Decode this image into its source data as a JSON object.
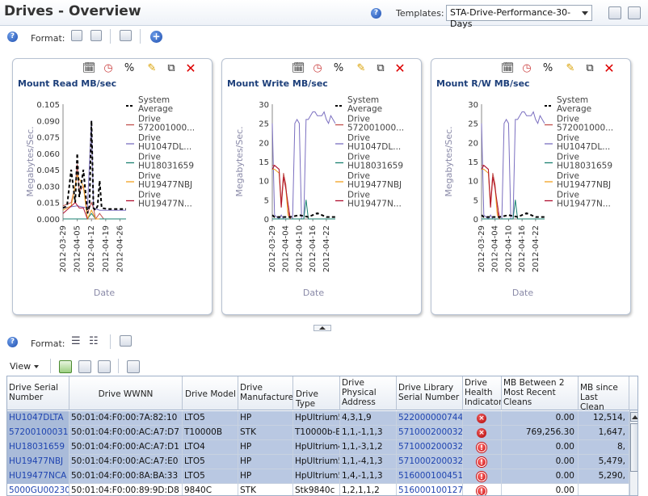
{
  "header": {
    "title": "Drives - Overview",
    "templates_label": "Templates:",
    "template_selected": "STA-Drive-Performance-30-Days"
  },
  "toolbar1": {
    "format_label": "Format:"
  },
  "toolbar2": {
    "format_label": "Format:",
    "view_label": "View"
  },
  "legend": [
    "System Average",
    "Drive 572001000...",
    "Drive HU1047DL...",
    "Drive HU18031659",
    "Drive HU19477NBJ",
    "Drive HU19477N..."
  ],
  "legend_lines": [
    [
      "System",
      "Average"
    ],
    [
      "Drive",
      "572001000..."
    ],
    [
      "Drive",
      "HU1047DL..."
    ],
    [
      "Drive",
      "HU18031659"
    ],
    [
      "Drive",
      "HU19477NBJ"
    ],
    [
      "Drive",
      "HU19477N..."
    ]
  ],
  "series_colors": [
    "#000000",
    "#c0504d",
    "#7b6fc0",
    "#1a8070",
    "#f0a020",
    "#b01030"
  ],
  "chart_data": [
    {
      "type": "line",
      "title": "Mount Read MB/sec",
      "xlabel": "Date",
      "ylabel": "Megabytes/Sec.",
      "ylim": [
        0,
        0.105
      ],
      "yticks": [
        "0.105",
        "0.090",
        "0.075",
        "0.060",
        "0.045",
        "0.030",
        "0.015",
        "0.000"
      ],
      "ytick_values": [
        0.105,
        0.09,
        0.075,
        0.06,
        0.045,
        0.03,
        0.015,
        0
      ],
      "xticks": [
        "2012-03-29",
        "2012-04-05",
        "2012-04-12",
        "2012-04-19",
        "2012-04-26"
      ],
      "xlim": [
        "2012-03-29",
        "2012-04-29"
      ],
      "series": [
        {
          "x": [
            "2012-03-29",
            "2012-03-31",
            "2012-04-02",
            "2012-04-04",
            "2012-04-05",
            "2012-04-06",
            "2012-04-08",
            "2012-04-10",
            "2012-04-11",
            "2012-04-12",
            "2012-04-13",
            "2012-04-14",
            "2012-04-15",
            "2012-04-16",
            "2012-04-17",
            "2012-04-20",
            "2012-04-24",
            "2012-04-29"
          ],
          "y": [
            0.01,
            0.012,
            0.045,
            0.015,
            0.06,
            0.02,
            0.045,
            0.005,
            0.012,
            0.09,
            0.01,
            0.008,
            0.012,
            0.035,
            0.01,
            0.009,
            0.009,
            0.009
          ]
        },
        {
          "x": [
            "2012-03-29",
            "2012-04-02",
            "2012-04-04",
            "2012-04-05",
            "2012-04-06",
            "2012-04-08",
            "2012-04-10",
            "2012-04-12",
            "2012-04-13",
            "2012-04-14",
            "2012-04-16",
            "2012-04-18"
          ],
          "y": [
            0.012,
            0.015,
            0.03,
            0.05,
            0.025,
            0.03,
            0.005,
            0.015,
            0.01,
            0.0,
            0.005,
            0.0
          ]
        },
        {
          "x": [
            "2012-03-29",
            "2012-04-05",
            "2012-04-10",
            "2012-04-12",
            "2012-04-13",
            "2012-04-16",
            "2012-04-20",
            "2012-04-29"
          ],
          "y": [
            0.01,
            0.012,
            0.01,
            0.09,
            0.01,
            0.008,
            0.008,
            0.008
          ]
        },
        {
          "x": [
            "2012-03-29",
            "2012-04-10",
            "2012-04-12",
            "2012-04-14",
            "2012-04-29"
          ],
          "y": [
            0.0,
            0.0,
            0.005,
            0.0,
            0.0
          ]
        },
        {
          "x": [
            "2012-03-29",
            "2012-04-02",
            "2012-04-05",
            "2012-04-08",
            "2012-04-10",
            "2012-04-12",
            "2012-04-14",
            "2012-04-16"
          ],
          "y": [
            0.008,
            0.012,
            0.04,
            0.03,
            0.0,
            0.008,
            0.0,
            0.0
          ]
        },
        {
          "x": [
            "2012-03-29",
            "2012-04-04",
            "2012-04-06",
            "2012-04-08",
            "2012-04-10"
          ],
          "y": [
            0.005,
            0.015,
            0.01,
            0.01,
            0.0
          ]
        }
      ]
    },
    {
      "type": "line",
      "title": "Mount Write MB/sec",
      "xlabel": "Date",
      "ylabel": "Megabytes/Sec.",
      "ylim": [
        0,
        30
      ],
      "yticks": [
        "30",
        "25",
        "20",
        "15",
        "10",
        "5",
        "0"
      ],
      "ytick_values": [
        30,
        25,
        20,
        15,
        10,
        5,
        0
      ],
      "xticks": [
        "2012-03-29",
        "2012-04-04",
        "2012-04-10",
        "2012-04-16",
        "2012-04-22"
      ],
      "xlim": [
        "2012-03-29",
        "2012-04-26"
      ],
      "series": [
        {
          "x": [
            "2012-03-29",
            "2012-03-30",
            "2012-04-01",
            "2012-04-06",
            "2012-04-10",
            "2012-04-14",
            "2012-04-18",
            "2012-04-22",
            "2012-04-26"
          ],
          "y": [
            1,
            0.5,
            0.5,
            0.5,
            1,
            0.5,
            1.5,
            0.5,
            0.5
          ]
        },
        {
          "x": [
            "2012-03-29",
            "2012-03-30",
            "2012-04-01",
            "2012-04-02",
            "2012-04-03",
            "2012-04-04",
            "2012-04-05",
            "2012-04-06"
          ],
          "y": [
            14,
            14,
            13,
            4,
            12,
            9,
            2,
            0
          ]
        },
        {
          "x": [
            "2012-03-29",
            "2012-03-30",
            "2012-04-01",
            "2012-04-02",
            "2012-04-03",
            "2012-04-06",
            "2012-04-07",
            "2012-04-08",
            "2012-04-09",
            "2012-04-10",
            "2012-04-11",
            "2012-04-12",
            "2012-04-13",
            "2012-04-14",
            "2012-04-16",
            "2012-04-17",
            "2012-04-18",
            "2012-04-19",
            "2012-04-20",
            "2012-04-21",
            "2012-04-22",
            "2012-04-23",
            "2012-04-24",
            "2012-04-26"
          ],
          "y": [
            25,
            1,
            0,
            1,
            0,
            0,
            0,
            25,
            26,
            25,
            0,
            0,
            26,
            26,
            28,
            28,
            27,
            27,
            27,
            28,
            26,
            25,
            27,
            25
          ]
        },
        {
          "x": [
            "2012-03-29",
            "2012-04-12",
            "2012-04-13",
            "2012-04-14",
            "2012-04-16",
            "2012-04-17",
            "2012-04-26"
          ],
          "y": [
            0,
            0,
            5,
            0,
            0,
            0,
            0
          ]
        },
        {
          "x": [
            "2012-03-29",
            "2012-03-30",
            "2012-04-01",
            "2012-04-02",
            "2012-04-03",
            "2012-04-04",
            "2012-04-05",
            "2012-04-06"
          ],
          "y": [
            13,
            13,
            12,
            3,
            11,
            8,
            1,
            0
          ]
        },
        {
          "x": [
            "2012-03-29",
            "2012-03-30",
            "2012-04-01",
            "2012-04-02",
            "2012-04-03",
            "2012-04-04",
            "2012-04-06"
          ],
          "y": [
            13,
            14,
            13,
            3,
            11,
            8,
            0
          ]
        }
      ]
    },
    {
      "type": "line",
      "title": "Mount R/W MB/sec",
      "xlabel": "Date",
      "ylabel": "Megabytes/Sec.",
      "ylim": [
        0,
        30
      ],
      "yticks": [
        "30",
        "25",
        "20",
        "15",
        "10",
        "5",
        "0"
      ],
      "ytick_values": [
        30,
        25,
        20,
        15,
        10,
        5,
        0
      ],
      "xticks": [
        "2012-03-29",
        "2012-04-04",
        "2012-04-10",
        "2012-04-16",
        "2012-04-22"
      ],
      "xlim": [
        "2012-03-29",
        "2012-04-26"
      ],
      "series": [
        {
          "x": [
            "2012-03-29",
            "2012-03-30",
            "2012-04-01",
            "2012-04-06",
            "2012-04-10",
            "2012-04-14",
            "2012-04-18",
            "2012-04-22",
            "2012-04-26"
          ],
          "y": [
            1,
            0.5,
            0.5,
            0.5,
            1,
            0.5,
            1.5,
            0.5,
            0.5
          ]
        },
        {
          "x": [
            "2012-03-29",
            "2012-03-30",
            "2012-04-01",
            "2012-04-02",
            "2012-04-03",
            "2012-04-04",
            "2012-04-05",
            "2012-04-06"
          ],
          "y": [
            14,
            14,
            13,
            4,
            12,
            9,
            2,
            0
          ]
        },
        {
          "x": [
            "2012-03-29",
            "2012-03-30",
            "2012-04-01",
            "2012-04-02",
            "2012-04-03",
            "2012-04-06",
            "2012-04-07",
            "2012-04-08",
            "2012-04-09",
            "2012-04-10",
            "2012-04-11",
            "2012-04-12",
            "2012-04-13",
            "2012-04-14",
            "2012-04-16",
            "2012-04-17",
            "2012-04-18",
            "2012-04-19",
            "2012-04-20",
            "2012-04-21",
            "2012-04-22",
            "2012-04-23",
            "2012-04-24",
            "2012-04-26"
          ],
          "y": [
            25,
            1,
            0,
            1,
            0,
            0,
            0,
            25,
            26,
            25,
            0,
            0,
            26,
            26,
            28,
            28,
            27,
            27,
            27,
            28,
            26,
            25,
            27,
            25
          ]
        },
        {
          "x": [
            "2012-03-29",
            "2012-04-12",
            "2012-04-13",
            "2012-04-14",
            "2012-04-16",
            "2012-04-17",
            "2012-04-26"
          ],
          "y": [
            0,
            0,
            5,
            0,
            0,
            0,
            0
          ]
        },
        {
          "x": [
            "2012-03-29",
            "2012-03-30",
            "2012-04-01",
            "2012-04-02",
            "2012-04-03",
            "2012-04-04",
            "2012-04-05",
            "2012-04-06"
          ],
          "y": [
            13,
            13,
            12,
            3,
            11,
            8,
            1,
            0
          ]
        },
        {
          "x": [
            "2012-03-29",
            "2012-03-30",
            "2012-04-01",
            "2012-04-02",
            "2012-04-03",
            "2012-04-04",
            "2012-04-06"
          ],
          "y": [
            13,
            14,
            13,
            3,
            11,
            8,
            0
          ]
        }
      ]
    }
  ],
  "table": {
    "columns": [
      [
        "Drive Serial",
        "Number"
      ],
      [
        "Drive WWNN"
      ],
      [
        "Drive Model"
      ],
      [
        "Drive",
        "Manufacturer"
      ],
      [
        "Drive Type"
      ],
      [
        "Drive",
        "Physical",
        "Address"
      ],
      [
        "Drive Library",
        "Serial Number"
      ],
      [
        "Drive",
        "Health",
        "Indicator"
      ],
      [
        "MB Between 2",
        "Most Recent",
        "Cleans"
      ],
      [
        "MB since Last",
        "Clean"
      ]
    ],
    "rows": [
      {
        "serial": "HU1047DLTA",
        "wwnn": "50:01:04:F0:00:7A:82:10",
        "model": "LTO5",
        "mfr": "HP",
        "type": "HpUltrium5",
        "addr": "4,3,1,9",
        "lib": "522000000744",
        "health": "error",
        "between": "0.00",
        "since": "12,514,"
      },
      {
        "serial": "572001000315",
        "wwnn": "50:01:04:F0:00:AC:A7:D7",
        "model": "T10000B",
        "mfr": "STK",
        "type": "T10000b-En",
        "addr": "1,1,-1,1,3",
        "lib": "571000200032",
        "health": "error",
        "between": "769,256.30",
        "since": "1,647,"
      },
      {
        "serial": "HU18031659",
        "wwnn": "50:01:04:F0:00:AC:A7:D1",
        "model": "LTO4",
        "mfr": "HP",
        "type": "HpUltrium4",
        "addr": "1,1,-3,1,2",
        "lib": "571000200032",
        "health": "warning",
        "between": "0.00",
        "since": "8,"
      },
      {
        "serial": "HU19477NBJ",
        "wwnn": "50:01:04:F0:00:AC:A7:E0",
        "model": "LTO5",
        "mfr": "HP",
        "type": "HpUltrium5",
        "addr": "1,1,-4,1,3",
        "lib": "571000200032",
        "health": "warning",
        "between": "0.00",
        "since": "5,479,"
      },
      {
        "serial": "HU19477NCA",
        "wwnn": "50:01:04:F0:00:8A:BA:33",
        "model": "LTO5",
        "mfr": "HP",
        "type": "HpUltrium5",
        "addr": "1,4,-1,1,3",
        "lib": "516000100451",
        "health": "warning",
        "between": "0.00",
        "since": "5,290,"
      },
      {
        "serial": "5000GU002306",
        "wwnn": "50:01:04:F0:00:89:9D:D8",
        "model": "9840C",
        "mfr": "STK",
        "type": "Stk9840c",
        "addr": "1,2,1,1,2",
        "lib": "516000100127",
        "health": "warning",
        "between": "0.00",
        "since": ""
      }
    ]
  }
}
